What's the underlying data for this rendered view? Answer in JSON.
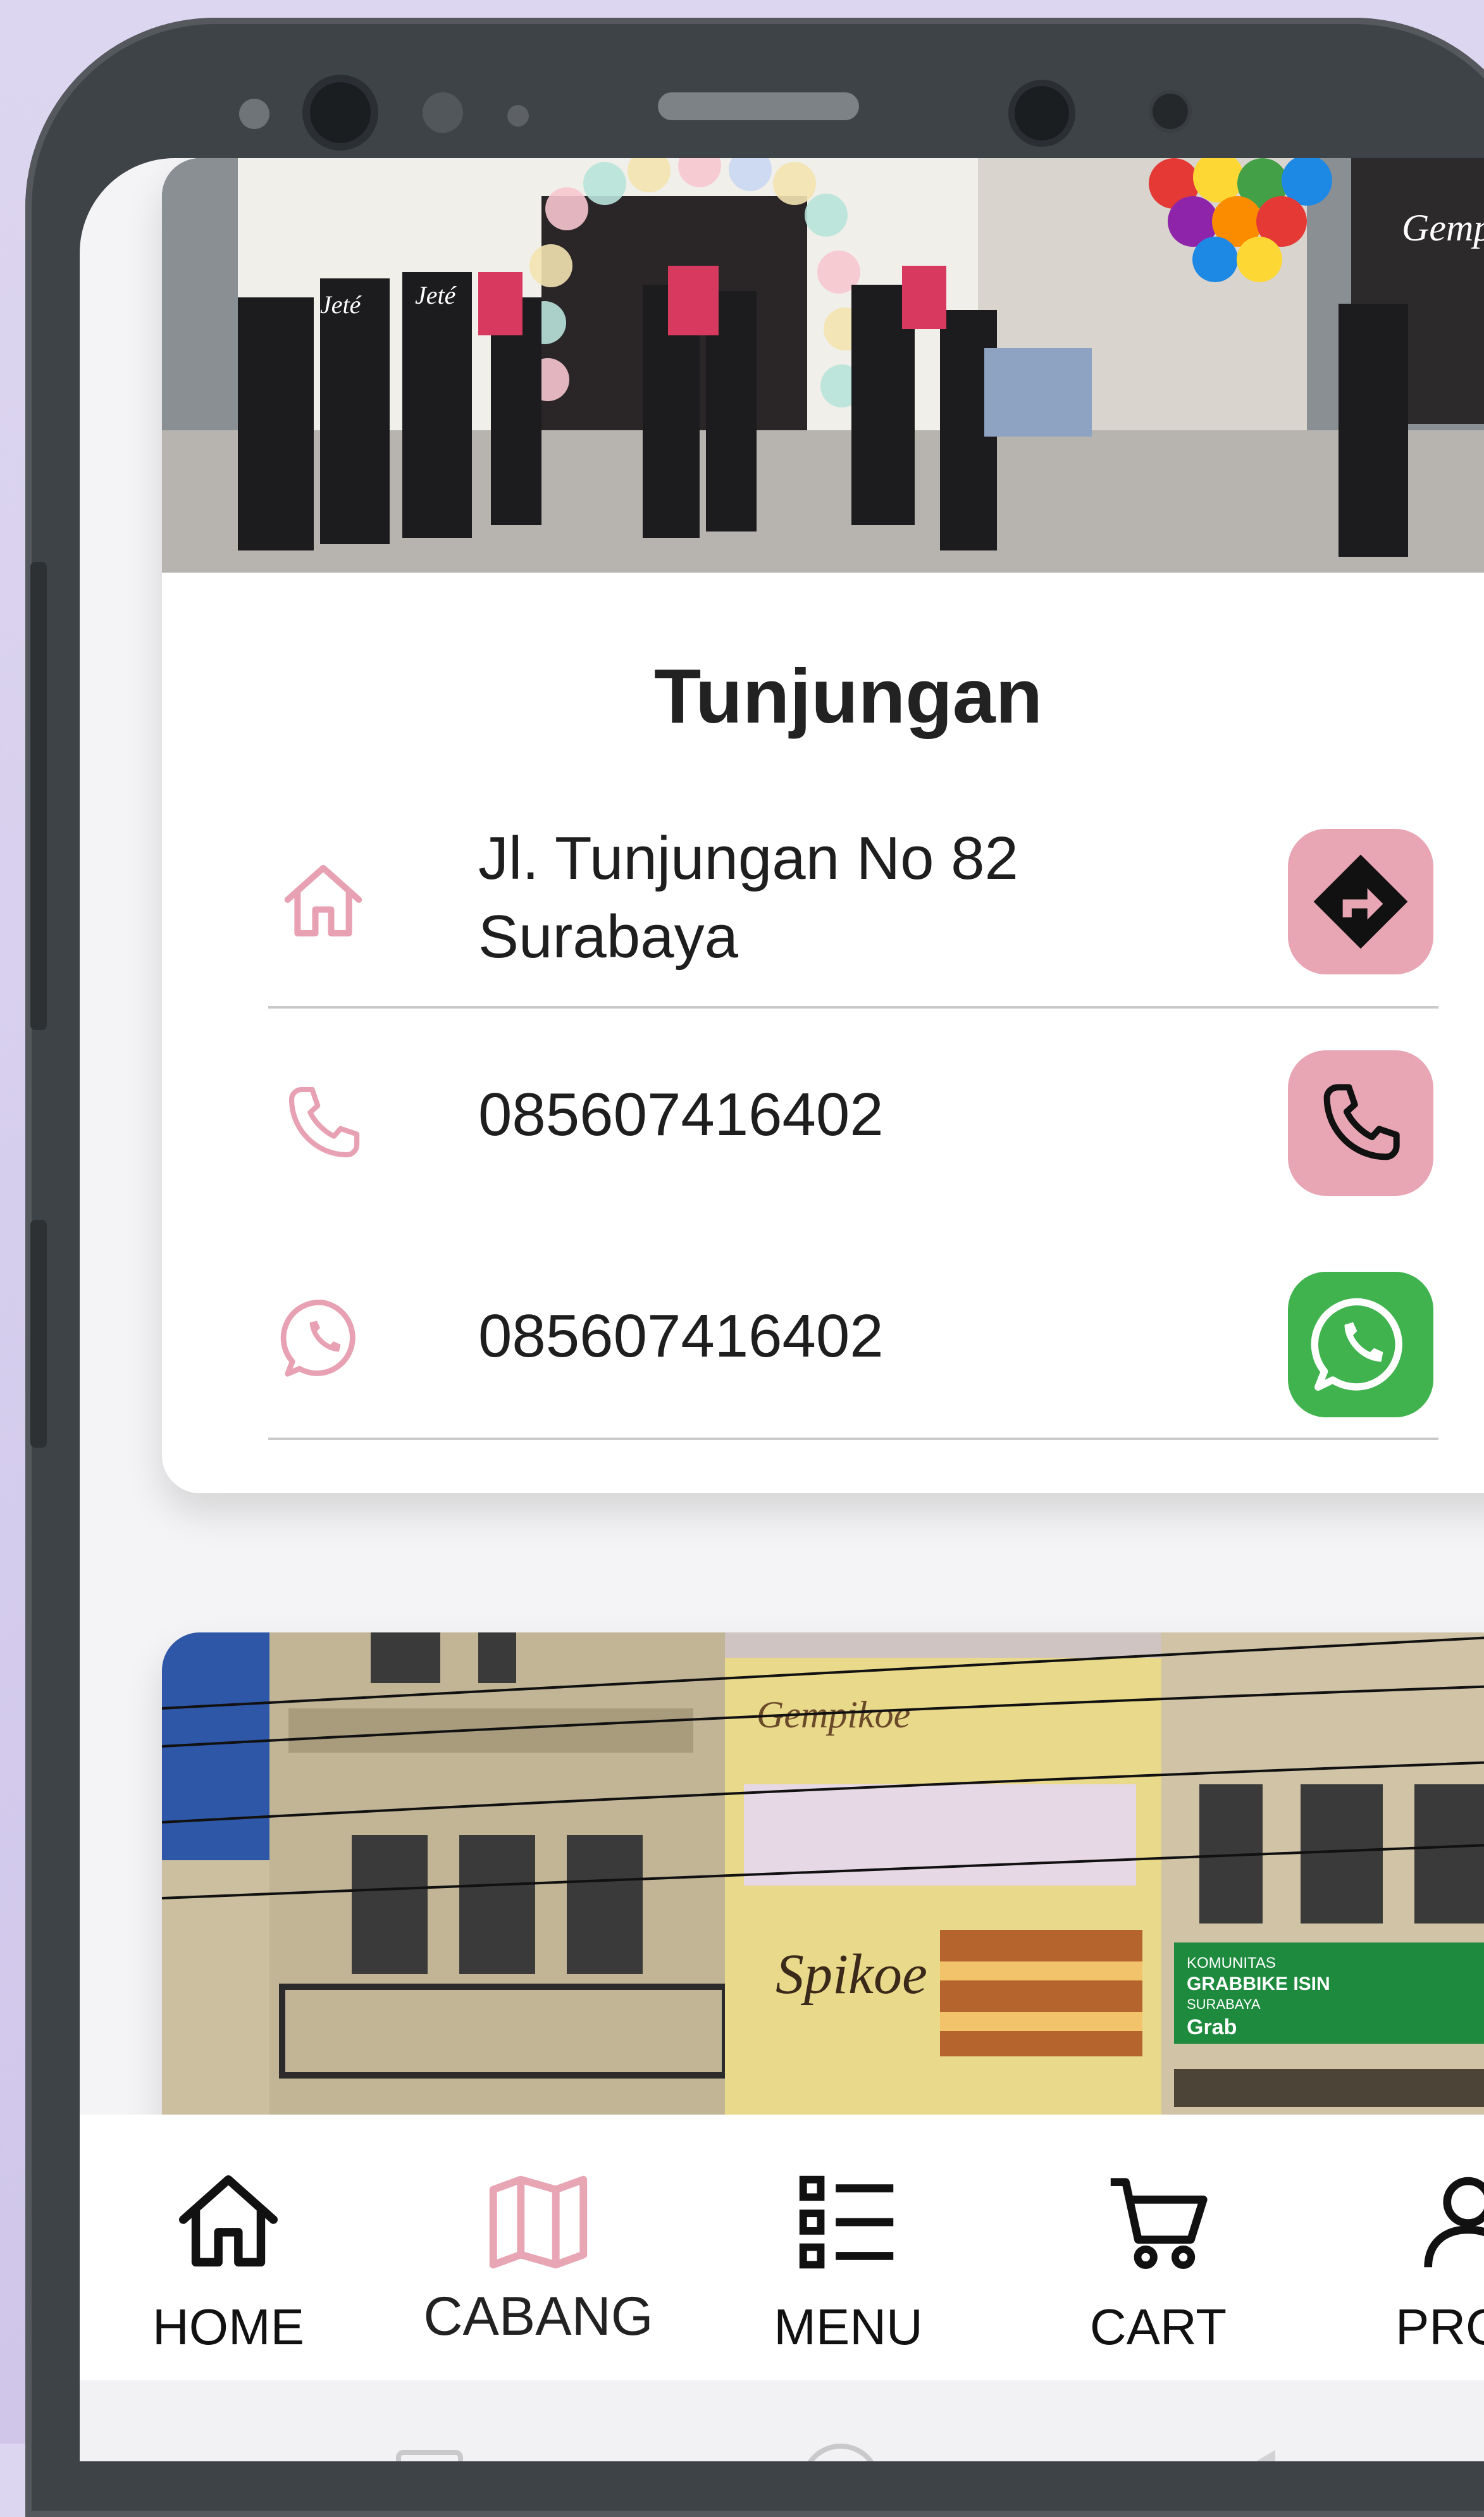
{
  "branches": [
    {
      "name": "Tunjungan",
      "address_line1": "Jl. Tunjungan No 82",
      "address_line2": "Surabaya",
      "phone": "085607416402",
      "whatsapp": "085607416402"
    },
    {
      "name": "",
      "photo_signs": {
        "brand": "Gempikoe",
        "product": "Spikoe",
        "green_banner_line1": "KOMUNITAS",
        "green_banner_line2": "GRABBIKE ISIN",
        "green_banner_line3": "SURABAYA",
        "green_banner_logo": "Grab"
      }
    }
  ],
  "photo_text": {
    "shirt_text": "Jeté",
    "shop_sign": "Gempi"
  },
  "nav": {
    "items": [
      {
        "label": "HOME",
        "icon": "home-icon"
      },
      {
        "label": "CABANG",
        "icon": "map-icon"
      },
      {
        "label": "MENU",
        "icon": "list-icon"
      },
      {
        "label": "CART",
        "icon": "cart-icon"
      },
      {
        "label": "PROF",
        "icon": "profile-icon"
      }
    ],
    "active_index": 1
  },
  "colors": {
    "accent_pink": "#e8a6b5",
    "icon_pink": "#e7a1b2",
    "whatsapp_green": "#40b34f",
    "text_dark": "#1e1e1e",
    "divider": "#c9c9c9"
  }
}
